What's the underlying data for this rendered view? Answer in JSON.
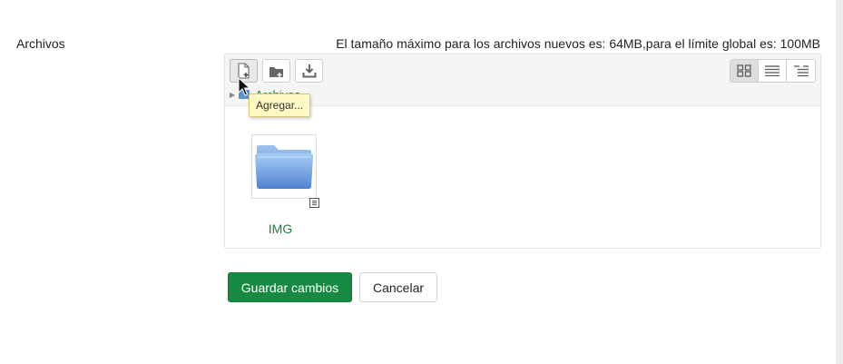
{
  "form": {
    "field_label": "Archivos",
    "size_info": "El tamaño máximo para los archivos nuevos es: 64MB,para el límite global es: 100MB"
  },
  "toolbar": {
    "buttons": [
      {
        "name": "add-file",
        "icon": "add-file-icon"
      },
      {
        "name": "create-folder",
        "icon": "create-folder-icon"
      },
      {
        "name": "download",
        "icon": "download-icon"
      }
    ],
    "views": [
      {
        "name": "icons-view",
        "icon": "grid-icon",
        "selected": true
      },
      {
        "name": "list-view",
        "icon": "list-icon",
        "selected": false
      },
      {
        "name": "tree-view",
        "icon": "tree-icon",
        "selected": false
      }
    ],
    "tooltip": "Agregar..."
  },
  "path": {
    "root_label": "Archivos"
  },
  "files": [
    {
      "name": "IMG",
      "type": "folder",
      "icon": "folder-icon"
    }
  ],
  "actions": {
    "save_label": "Guardar cambios",
    "cancel_label": "Cancelar"
  },
  "colors": {
    "accent_green": "#168a42",
    "link_green": "#1b7f3b",
    "tooltip_bg": "#fff9c4"
  }
}
